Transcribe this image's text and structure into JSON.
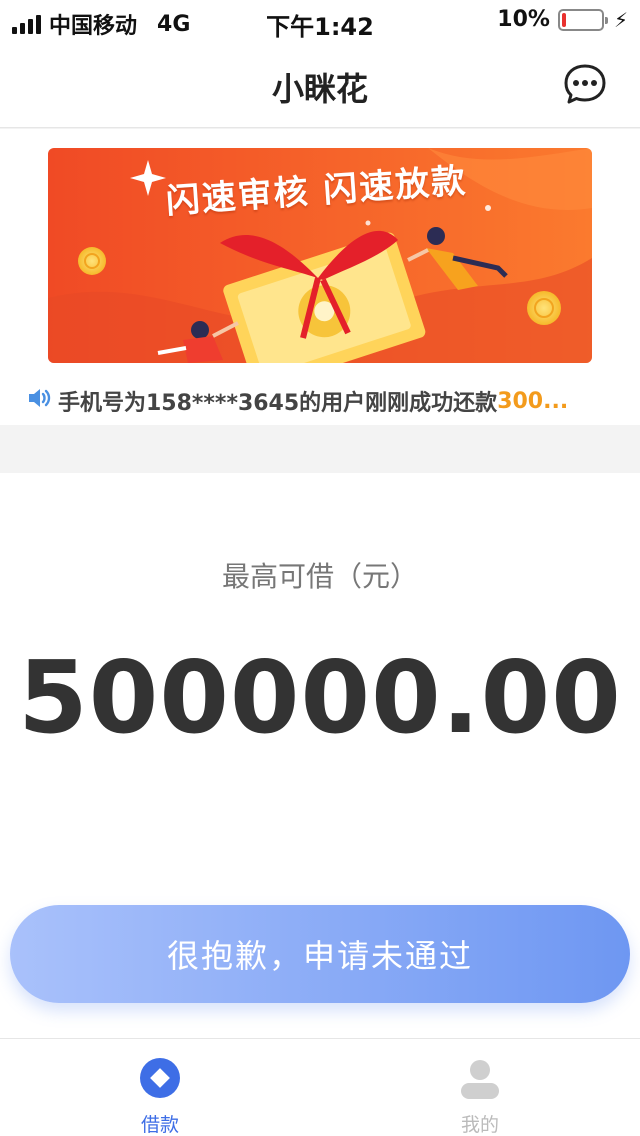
{
  "status_bar": {
    "carrier": "中国移动",
    "network": "4G",
    "time": "下午1:42",
    "battery_percent": "10%",
    "battery_level": 0.1
  },
  "nav": {
    "title": "小眯花",
    "more_icon": "more-dots-icon"
  },
  "banner": {
    "headline": "闪速审核 闪速放款"
  },
  "notice": {
    "icon": "speaker-icon",
    "text": "手机号为158****3645的用户刚刚成功还款",
    "amount": "300..."
  },
  "loan": {
    "label": "最高可借（元）",
    "amount": "500000.00"
  },
  "action": {
    "button_label": "很抱歉，申请未通过"
  },
  "tabs": [
    {
      "label": "借款",
      "icon": "loan-diamond-icon",
      "active": true
    },
    {
      "label": "我的",
      "icon": "user-icon",
      "active": false
    }
  ],
  "colors": {
    "accent": "#3e6ee6",
    "banner_orange": "#f0572a",
    "notice_amount": "#f39b1c",
    "battery_low": "#e8312f"
  }
}
